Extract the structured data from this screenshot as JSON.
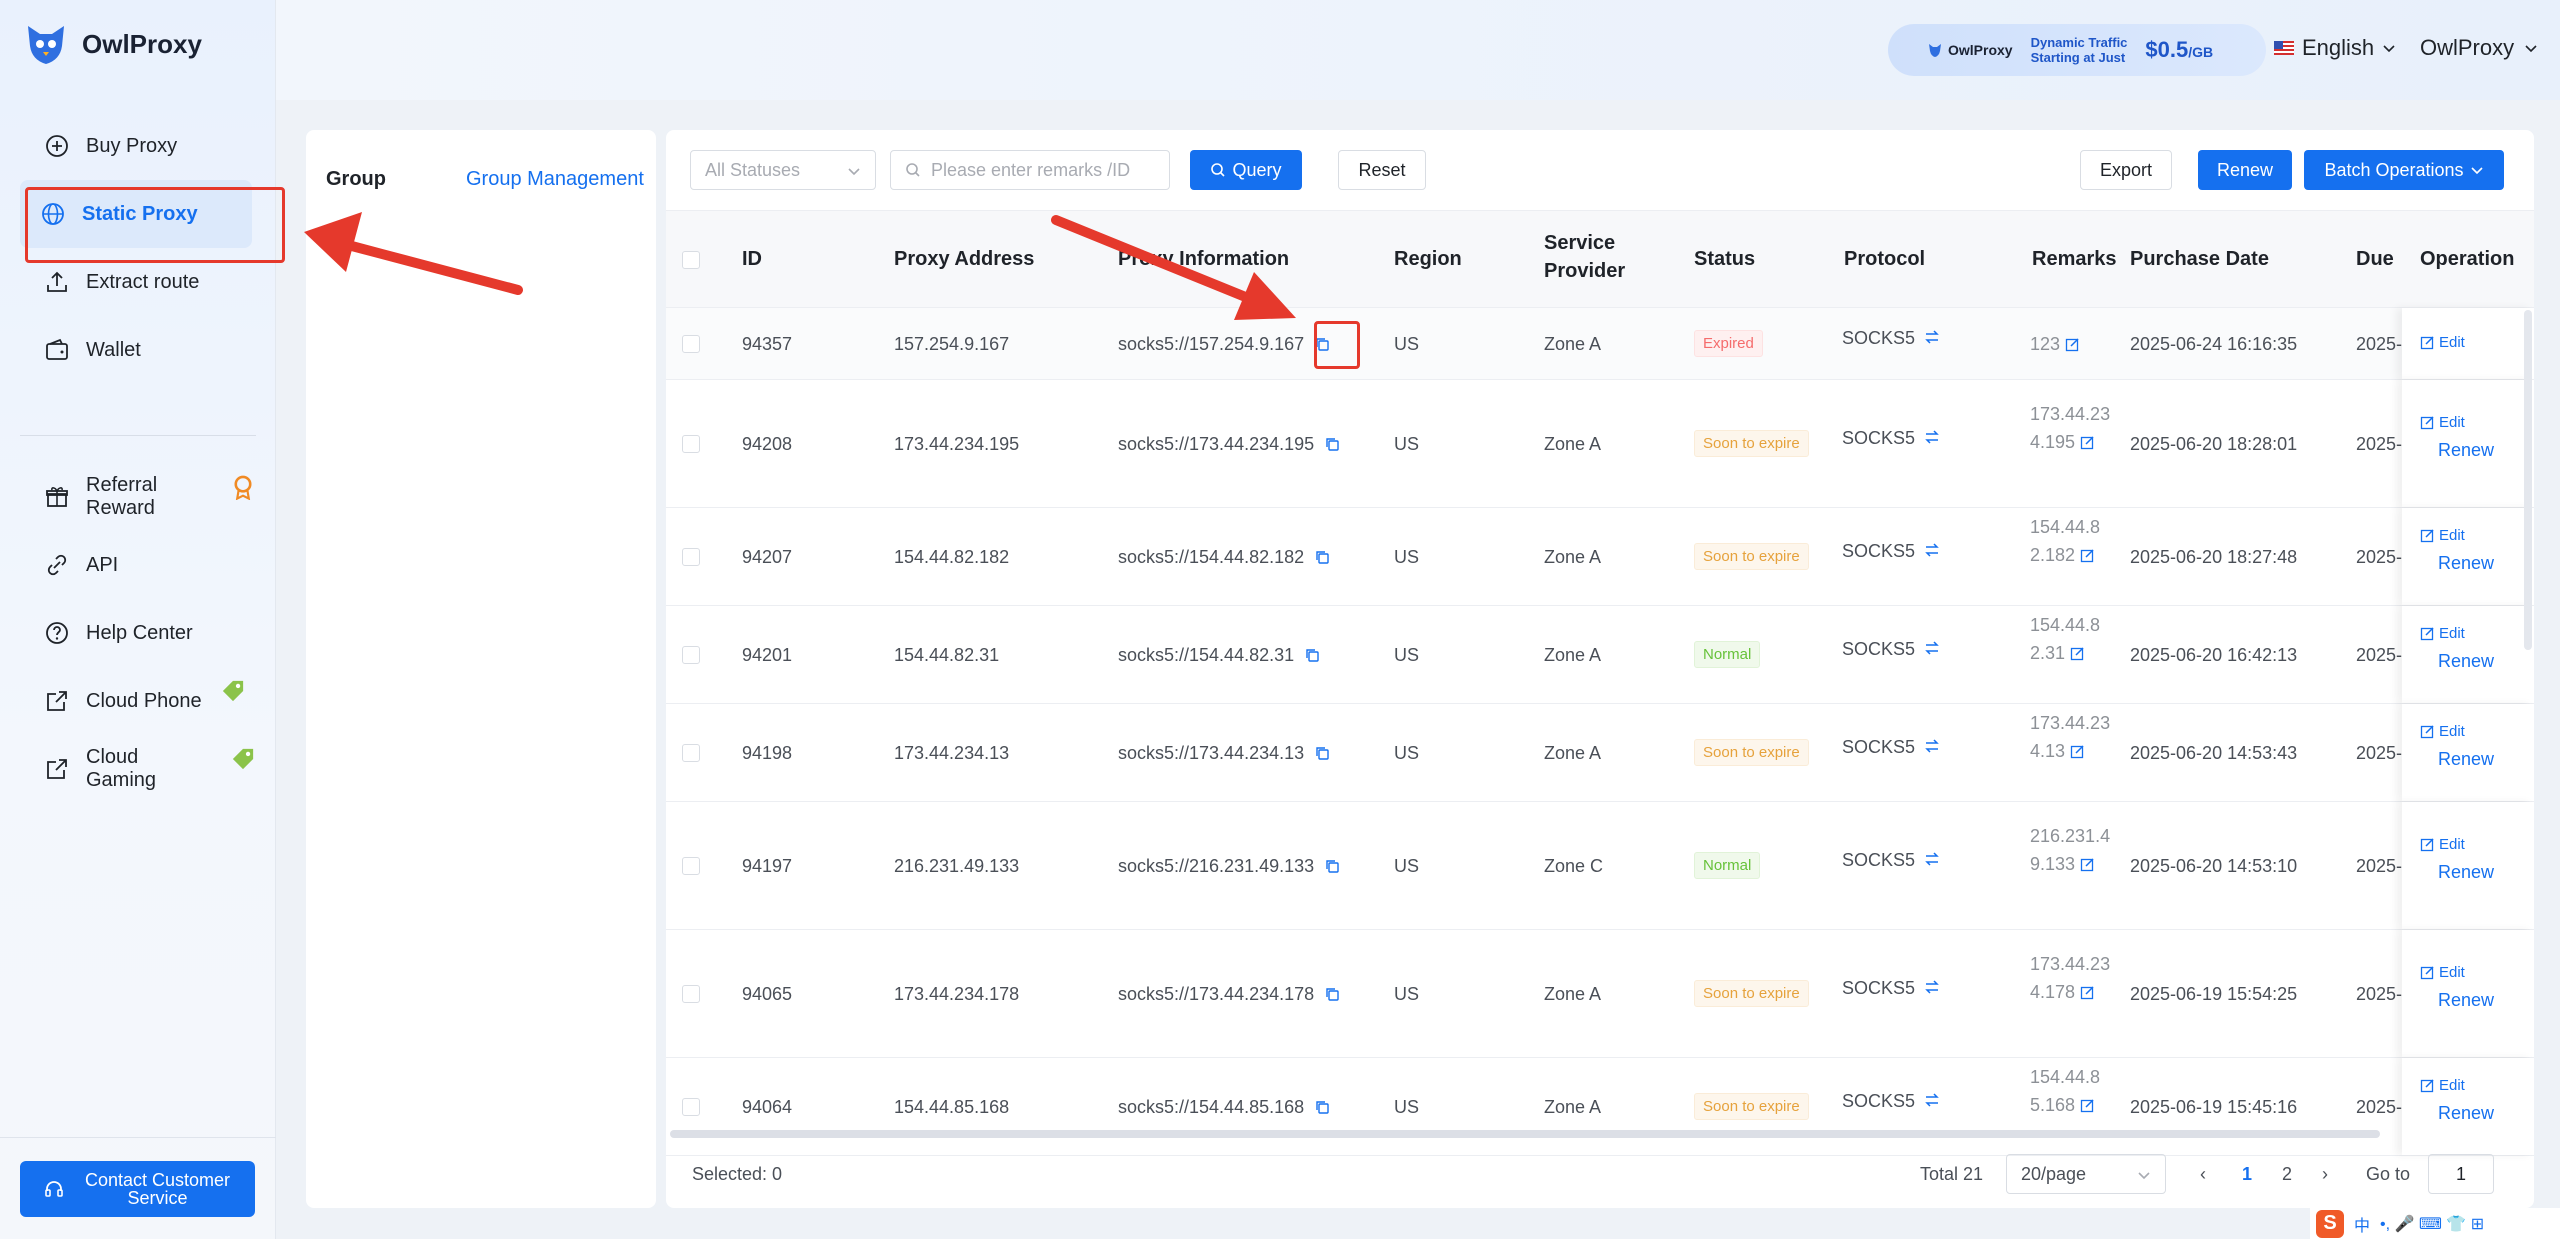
{
  "app": {
    "name": "OwlProxy"
  },
  "header": {
    "promo": {
      "brand": "OwlProxy",
      "line1": "Dynamic Traffic",
      "line2": "Starting at Just",
      "price": "$0.5",
      "unit": "/GB"
    },
    "language": "English",
    "user": "OwlProxy"
  },
  "sidebar": {
    "items": [
      {
        "label": "Buy Proxy",
        "icon": "plus-circle-icon"
      },
      {
        "label": "Static Proxy",
        "icon": "globe-icon",
        "active": true
      },
      {
        "label": "Extract route",
        "icon": "upload-icon"
      },
      {
        "label": "Wallet",
        "icon": "wallet-icon"
      },
      {
        "label": "Referral Reward",
        "icon": "gift-icon"
      },
      {
        "label": "API",
        "icon": "link-icon"
      },
      {
        "label": "Help Center",
        "icon": "question-circle-icon"
      },
      {
        "label": "Cloud Phone",
        "icon": "external-icon"
      },
      {
        "label": "Cloud Gaming",
        "icon": "external-icon"
      }
    ],
    "contact": "Contact Customer Service"
  },
  "group": {
    "title": "Group",
    "manage": "Group Management"
  },
  "toolbar": {
    "status_select": "All Statuses",
    "search_placeholder": "Please enter remarks /ID",
    "query": "Query",
    "reset": "Reset",
    "export": "Export",
    "renew": "Renew",
    "batch": "Batch Operations"
  },
  "table": {
    "columns": {
      "id": "ID",
      "address": "Proxy Address",
      "info": "Proxy Information",
      "region": "Region",
      "provider_line1": "Service",
      "provider_line2": "Provider",
      "status": "Status",
      "protocol": "Protocol",
      "remarks": "Remarks",
      "purchase": "Purchase Date",
      "due": "Due d",
      "operation": "Operation"
    },
    "edit_label": "Edit",
    "renew_label": "Renew",
    "rows": [
      {
        "id": "94357",
        "address": "157.254.9.167",
        "info": "socks5://157.254.9.167",
        "region": "US",
        "provider": "Zone A",
        "status": "Expired",
        "status_kind": "expired",
        "protocol": "SOCKS5",
        "remarks": "123",
        "purchase": "2025-06-24 16:16:35",
        "due": "2025-",
        "renew": false
      },
      {
        "id": "94208",
        "address": "173.44.234.195",
        "info": "socks5://173.44.234.195",
        "region": "US",
        "provider": "Zone A",
        "status": "Soon to expire",
        "status_kind": "soon",
        "protocol": "SOCKS5",
        "remarks": "173.44.234.195",
        "purchase": "2025-06-20 18:28:01",
        "due": "2025-",
        "renew": true
      },
      {
        "id": "94207",
        "address": "154.44.82.182",
        "info": "socks5://154.44.82.182",
        "region": "US",
        "provider": "Zone A",
        "status": "Soon to expire",
        "status_kind": "soon",
        "protocol": "SOCKS5",
        "remarks": "154.44.82.182",
        "purchase": "2025-06-20 18:27:48",
        "due": "2025-",
        "renew": true
      },
      {
        "id": "94201",
        "address": "154.44.82.31",
        "info": "socks5://154.44.82.31",
        "region": "US",
        "provider": "Zone A",
        "status": "Normal",
        "status_kind": "normal",
        "protocol": "SOCKS5",
        "remarks": "154.44.82.31",
        "purchase": "2025-06-20 16:42:13",
        "due": "2025-",
        "renew": true
      },
      {
        "id": "94198",
        "address": "173.44.234.13",
        "info": "socks5://173.44.234.13",
        "region": "US",
        "provider": "Zone A",
        "status": "Soon to expire",
        "status_kind": "soon",
        "protocol": "SOCKS5",
        "remarks": "173.44.234.13",
        "purchase": "2025-06-20 14:53:43",
        "due": "2025-",
        "renew": true
      },
      {
        "id": "94197",
        "address": "216.231.49.133",
        "info": "socks5://216.231.49.133",
        "region": "US",
        "provider": "Zone C",
        "status": "Normal",
        "status_kind": "normal",
        "protocol": "SOCKS5",
        "remarks": "216.231.49.133",
        "purchase": "2025-06-20 14:53:10",
        "due": "2025-",
        "renew": true
      },
      {
        "id": "94065",
        "address": "173.44.234.178",
        "info": "socks5://173.44.234.178",
        "region": "US",
        "provider": "Zone A",
        "status": "Soon to expire",
        "status_kind": "soon",
        "protocol": "SOCKS5",
        "remarks": "173.44.234.178",
        "purchase": "2025-06-19 15:54:25",
        "due": "2025-",
        "renew": true
      },
      {
        "id": "94064",
        "address": "154.44.85.168",
        "info": "socks5://154.44.85.168",
        "region": "US",
        "provider": "Zone A",
        "status": "Soon to expire",
        "status_kind": "soon",
        "protocol": "SOCKS5",
        "remarks": "154.44.85.168",
        "purchase": "2025-06-19 15:45:16",
        "due": "2025-",
        "renew": true
      }
    ]
  },
  "footer": {
    "selected": "Selected: 0",
    "total": "Total 21",
    "page_size": "20/page",
    "pages": [
      "1",
      "2"
    ],
    "current_page": "1",
    "goto_label": "Go to",
    "goto_value": "1"
  },
  "ime": {
    "label": "中"
  }
}
